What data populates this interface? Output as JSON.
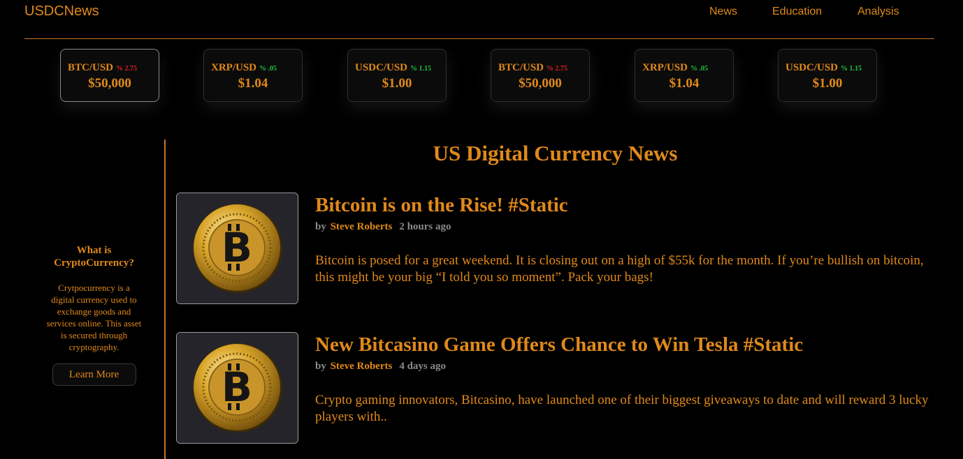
{
  "header": {
    "brand": "USDCNews",
    "nav": [
      "News",
      "Education",
      "Analysis"
    ]
  },
  "tickers": [
    {
      "pair": "BTC/USD",
      "change": "% 2.75",
      "direction": "down",
      "price": "$50,000"
    },
    {
      "pair": "XRP/USD",
      "change": "% .05",
      "direction": "up",
      "price": "$1.04"
    },
    {
      "pair": "USDC/USD",
      "change": "% 1.15",
      "direction": "up",
      "price": "$1.00"
    },
    {
      "pair": "BTC/USD",
      "change": "% 2.75",
      "direction": "down",
      "price": "$50,000"
    },
    {
      "pair": "XRP/USD",
      "change": "% .05",
      "direction": "up",
      "price": "$1.04"
    },
    {
      "pair": "USDC/USD",
      "change": "% 1.15",
      "direction": "up",
      "price": "$1.00"
    }
  ],
  "sidebar": {
    "title": "What is CryptoCurrency?",
    "text": "Crytpocurrency is a digital currency used to exchange goods and services online. This asset is secured through cryptography.",
    "button": "Learn More"
  },
  "main": {
    "title": "US Digital Currency News",
    "articles": [
      {
        "headline": "Bitcoin is on the Rise! #Static",
        "by": "by",
        "author": "Steve Roberts",
        "time": "2 hours ago",
        "excerpt": "Bitcoin is posed for a great weekend. It is closing out on a high of $55k for the month. If you’re bullish on bitcoin, this might be your big “I told you so moment”. Pack your bags!",
        "image_icon": "bitcoin-coin-image"
      },
      {
        "headline": "New Bitcasino Game Offers Chance to Win Tesla #Static",
        "by": "by",
        "author": "Steve Roberts",
        "time": "4 days ago",
        "excerpt": "Crypto gaming innovators, Bitcasino, have launched one of their biggest giveaways to date and will reward 3 lucky players with..",
        "image_icon": "bitcoin-coin-image"
      }
    ]
  },
  "colors": {
    "accent": "#e0891a",
    "background": "#000000",
    "up": "#20c040",
    "down": "#e02020",
    "muted": "#8a8a8a"
  }
}
